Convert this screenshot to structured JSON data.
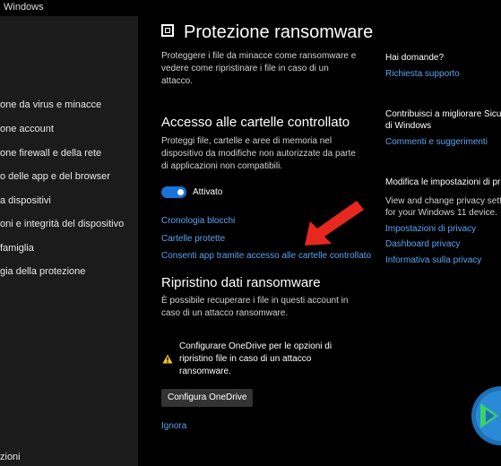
{
  "window": {
    "title": "Windows"
  },
  "sidebar": {
    "items": [
      {
        "label": "one da virus e minacce"
      },
      {
        "label": "one account"
      },
      {
        "label": "one firewall e della rete"
      },
      {
        "label": "o delle app e del browser"
      },
      {
        "label": "a dispositivi"
      },
      {
        "label": "oni e integrità del dispositivo"
      },
      {
        "label": "famiglia"
      },
      {
        "label": "gia della protezione"
      }
    ],
    "bottom_label": "zioni"
  },
  "header": {
    "title": "Protezione ransomware",
    "description": "Proteggere i file da minacce come ransomware e vedere come ripristinare i file in caso di un attacco."
  },
  "cfa": {
    "title": "Accesso alle cartelle controllato",
    "description": "Proteggi file, cartelle e aree di memoria nel dispositivo da modifiche non autorizzate da parte di applicazioni non compatibili.",
    "toggle_label": "Attivato",
    "toggle_on": true,
    "links": [
      "Cronologia blocchi",
      "Cartelle protette",
      "Consenti app tramite accesso alle cartelle controllato"
    ]
  },
  "recovery": {
    "title": "Ripristino dati ransomware",
    "description": "È possibile recuperare i file in questi account in caso di un attacco ransomware.",
    "warning": "Configurare OneDrive per le opzioni di ripristino file in caso di un attacco ransomware.",
    "button_label": "Configura OneDrive",
    "ignore_label": "Ignora"
  },
  "right": {
    "questions_title": "Hai domande?",
    "support_link": "Richiesta supporto",
    "improve_title_1": "Contribuisci a migliorare Sicu",
    "improve_title_2": "di Windows",
    "feedback_link": "Commenti e suggerimenti",
    "privacy_title": "Modifica le impostazioni di pr",
    "privacy_text_1": "View and change privacy setti",
    "privacy_text_2": "for your Windows 11 device.",
    "privacy_links": [
      "Impostazioni di privacy",
      "Dashboard privacy",
      "Informativa sulla privacy"
    ]
  },
  "colors": {
    "accent": "#1a73d9",
    "link": "#5aa3f0",
    "warning": "#f4c430",
    "arrow": "#e8281e"
  }
}
